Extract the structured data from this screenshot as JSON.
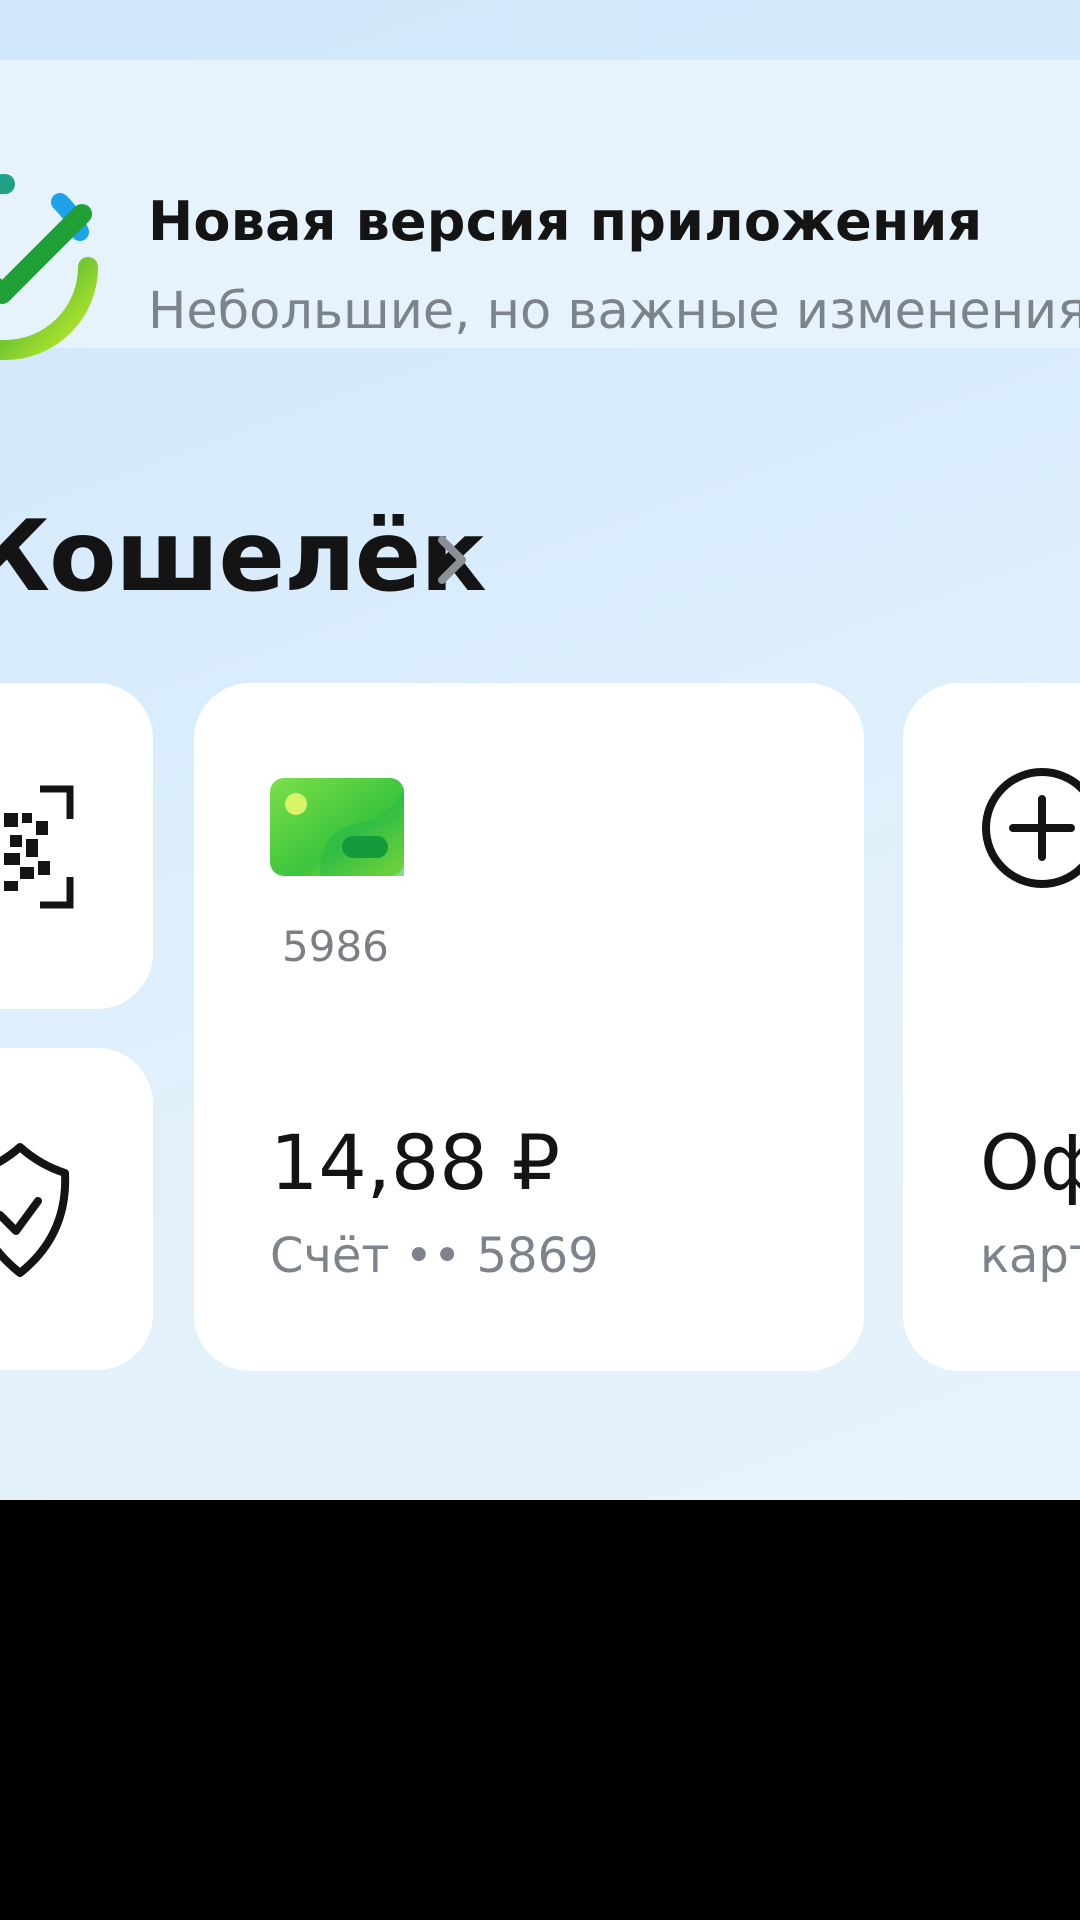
{
  "banner": {
    "title": "Новая версия приложения",
    "subtitle": "Небольшие, но важные изменения",
    "logo_icon": "sber-check-logo-icon"
  },
  "wallet": {
    "title": "Кошелёк",
    "chevron_icon": "chevron-right-icon"
  },
  "tiles": {
    "qr_icon": "qr-scan-icon",
    "shield_icon": "shield-check-icon"
  },
  "main_card": {
    "card_number": "5986",
    "balance": "14,88 ₽",
    "account": "Счёт •• 5869"
  },
  "add_card": {
    "icon": "plus-circle-icon",
    "title": "Оформить",
    "subtitle": "карту"
  },
  "colors": {
    "background_top": "#cfe6fb",
    "card": "#ffffff",
    "text_primary": "#141414",
    "text_secondary": "#7c838a",
    "accent_green": "#21a038",
    "accent_lime": "#c8ef2a"
  }
}
